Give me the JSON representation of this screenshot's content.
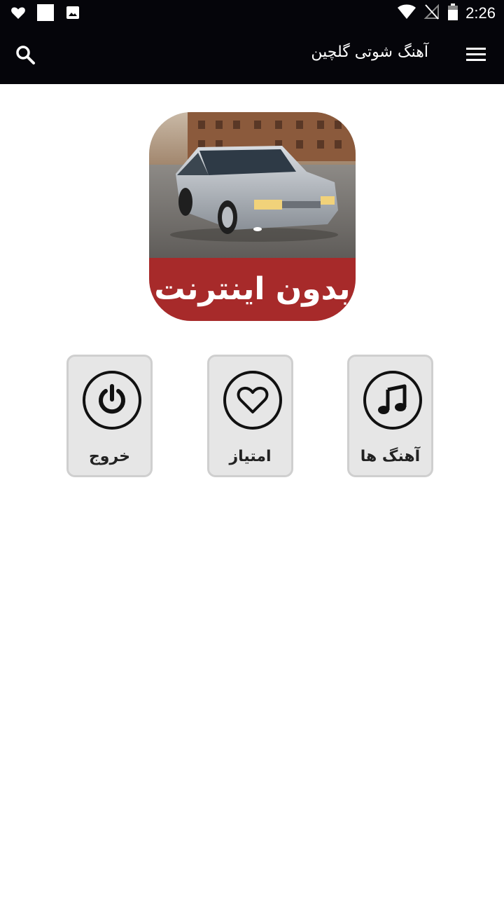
{
  "status_bar": {
    "time": "2:26",
    "left_icons": [
      "heart-icon",
      "square-icon",
      "image-icon"
    ],
    "right_icons": [
      "wifi-icon",
      "no-signal-icon",
      "battery-icon"
    ]
  },
  "toolbar": {
    "title": "آهنگ شوتی گلچین",
    "menu_icon": "menu-icon",
    "search_icon": "search-icon"
  },
  "logo": {
    "banner_text": "بدون اینترنت",
    "banner_color": "#a72a2a"
  },
  "tiles": [
    {
      "label": "آهنگ ها",
      "icon": "music-note-icon"
    },
    {
      "label": "امتیاز",
      "icon": "heart-outline-icon"
    },
    {
      "label": "خروج",
      "icon": "power-icon"
    }
  ],
  "colors": {
    "bar_background": "#05050a",
    "tile_background": "#e6e6e6",
    "tile_border": "#cfcfcf"
  }
}
